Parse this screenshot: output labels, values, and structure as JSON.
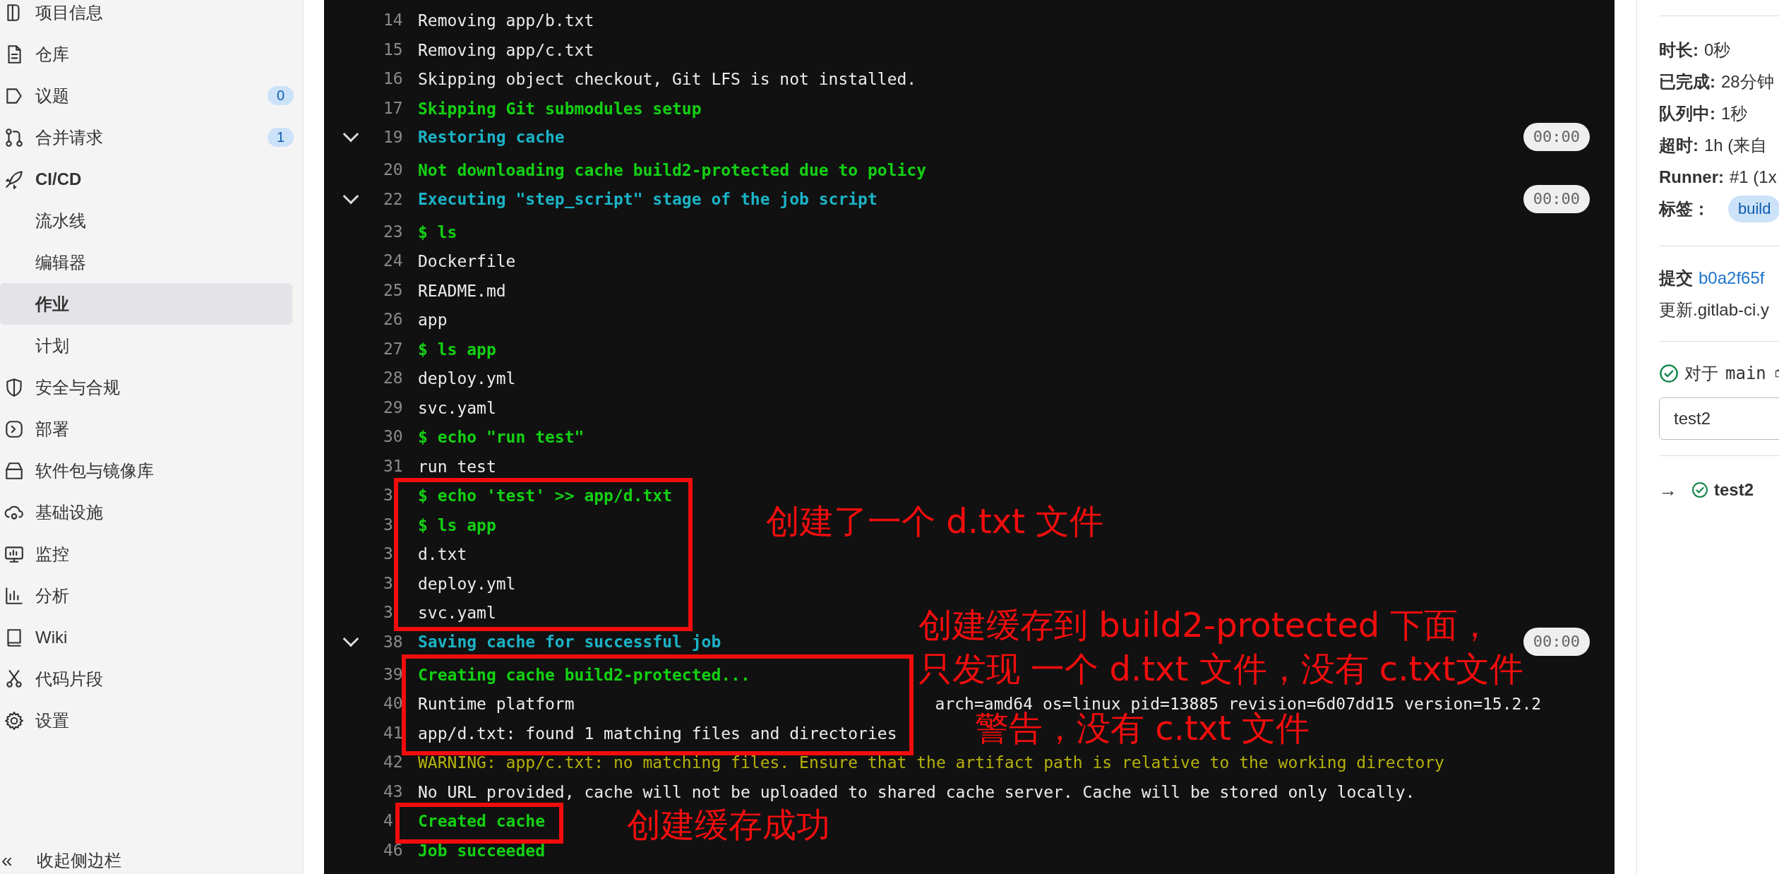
{
  "sidebar": {
    "items": [
      {
        "label": "项目信息",
        "selected": false
      },
      {
        "label": "仓库",
        "selected": false
      },
      {
        "label": "议题",
        "selected": false,
        "badge": "0"
      },
      {
        "label": "合并请求",
        "selected": false,
        "badge": "1"
      },
      {
        "label": "CI/CD",
        "selected": false,
        "children": [
          {
            "label": "流水线",
            "selected": false
          },
          {
            "label": "编辑器",
            "selected": false
          },
          {
            "label": "作业",
            "selected": true
          },
          {
            "label": "计划",
            "selected": false
          }
        ]
      },
      {
        "label": "安全与合规",
        "selected": false
      },
      {
        "label": "部署",
        "selected": false
      },
      {
        "label": "软件包与镜像库",
        "selected": false
      },
      {
        "label": "基础设施",
        "selected": false
      },
      {
        "label": "监控",
        "selected": false
      },
      {
        "label": "分析",
        "selected": false
      },
      {
        "label": "Wiki",
        "selected": false
      },
      {
        "label": "代码片段",
        "selected": false
      },
      {
        "label": "设置",
        "selected": false
      }
    ],
    "collapse": {
      "icon": "«",
      "label": "收起侧边栏"
    }
  },
  "log": {
    "lines": [
      {
        "n": "14",
        "kind": "plain",
        "text": "Removing app/b.txt"
      },
      {
        "n": "15",
        "kind": "plain",
        "text": "Removing app/c.txt"
      },
      {
        "n": "16",
        "kind": "plain",
        "text": "Skipping object checkout, Git LFS is not installed."
      },
      {
        "n": "17",
        "kind": "success",
        "text": "Skipping Git submodules setup"
      },
      {
        "n": "19",
        "kind": "section",
        "text": "Restoring cache",
        "expanded": true,
        "duration": "00:00"
      },
      {
        "n": "20",
        "kind": "success",
        "text": "Not downloading cache build2-protected due to policy"
      },
      {
        "n": "22",
        "kind": "section",
        "text": "Executing \"step_script\" stage of the job script",
        "expanded": true,
        "duration": "00:00"
      },
      {
        "n": "23",
        "kind": "success",
        "text": "$ ls"
      },
      {
        "n": "24",
        "kind": "plain",
        "text": "Dockerfile"
      },
      {
        "n": "25",
        "kind": "plain",
        "text": "README.md"
      },
      {
        "n": "26",
        "kind": "plain",
        "text": "app"
      },
      {
        "n": "27",
        "kind": "success",
        "text": "$ ls app"
      },
      {
        "n": "28",
        "kind": "plain",
        "text": "deploy.yml"
      },
      {
        "n": "29",
        "kind": "plain",
        "text": "svc.yaml"
      },
      {
        "n": "30",
        "kind": "success",
        "text": "$ echo \"run test\""
      },
      {
        "n": "31",
        "kind": "plain",
        "text": "run test"
      },
      {
        "n": "3",
        "kind": "success",
        "text": "$ echo 'test' >> app/d.txt"
      },
      {
        "n": "3",
        "kind": "success",
        "text": "$ ls app"
      },
      {
        "n": "3",
        "kind": "plain",
        "text": "d.txt"
      },
      {
        "n": "3",
        "kind": "plain",
        "text": "deploy.yml"
      },
      {
        "n": "3",
        "kind": "plain",
        "text": "svc.yaml"
      },
      {
        "n": "38",
        "kind": "section",
        "text": "Saving cache for successful job",
        "expanded": true,
        "duration": "00:00"
      },
      {
        "n": "39",
        "kind": "success",
        "text": "Creating cache build2-protected..."
      },
      {
        "n": "40",
        "kind": "plain",
        "text": "Runtime platform",
        "extra": "arch=amd64 os=linux pid=13885 revision=6d07dd15 version=15.2.2"
      },
      {
        "n": "41",
        "kind": "plain",
        "text": "app/d.txt: found 1 matching files and directories"
      },
      {
        "n": "42",
        "kind": "warning",
        "text": "WARNING: app/c.txt: no matching files. Ensure that the artifact path is relative to the working directory"
      },
      {
        "n": "43",
        "kind": "plain",
        "text": "No URL provided, cache will not be uploaded to shared cache server. Cache will be stored only locally."
      },
      {
        "n": "4",
        "kind": "success",
        "text": "Created cache"
      },
      {
        "n": "46",
        "kind": "success",
        "text": "Job succeeded"
      }
    ]
  },
  "annotations": [
    {
      "kind": "box"
    },
    {
      "kind": "box"
    },
    {
      "kind": "box"
    },
    {
      "kind": "note",
      "lines": [
        "创建了一个 d.txt 文件"
      ]
    },
    {
      "kind": "note",
      "lines": [
        "创建缓存到 build2-protected 下面，",
        "只发现 一个 d.txt 文件，没有 c.txt文件"
      ]
    },
    {
      "kind": "note",
      "lines": [
        "警告，没有 c.txt 文件"
      ]
    },
    {
      "kind": "note",
      "lines": [
        "创建缓存成功"
      ]
    }
  ],
  "details": {
    "meta": [
      {
        "label": "时长:",
        "value": "0秒"
      },
      {
        "label": "已完成:",
        "value": "28分钟"
      },
      {
        "label": "队列中:",
        "value": "1秒"
      },
      {
        "label": "超时:",
        "value": "1h (来自"
      },
      {
        "label": "Runner:",
        "value": "#1 (1x"
      }
    ],
    "tags": {
      "label": "标签：",
      "items": [
        "build"
      ]
    },
    "commit": {
      "label": "提交",
      "sha": "b0a2f65f",
      "message": "更新.gitlab-ci.y"
    },
    "pipeline": {
      "prefix": "对于",
      "branch": "main"
    },
    "stage": {
      "value": "test2"
    },
    "job": {
      "arrow": "→",
      "name": "test2"
    }
  }
}
